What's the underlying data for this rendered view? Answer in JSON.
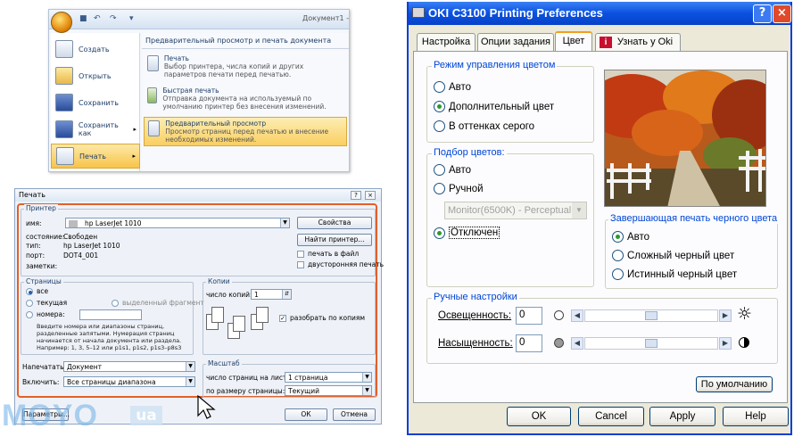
{
  "office": {
    "title": "Документ1 -",
    "left_items": [
      {
        "label": "Создать",
        "icon": "new-document-icon"
      },
      {
        "label": "Открыть",
        "icon": "open-folder-icon"
      },
      {
        "label": "Сохранить",
        "icon": "save-icon"
      },
      {
        "label": "Сохранить как",
        "icon": "save-as-icon"
      },
      {
        "label": "Печать",
        "icon": "printer-icon"
      }
    ],
    "right_header": "Предварительный просмотр и печать документа",
    "right_items": [
      {
        "title": "Печать",
        "desc": "Выбор принтера, числа копий и других параметров печати перед печатью."
      },
      {
        "title": "Быстрая печать",
        "desc": "Отправка документа на используемый по умолчанию принтер без внесения изменений."
      },
      {
        "title": "Предварительный просмотр",
        "desc": "Просмотр страниц перед печатью и внесение необходимых изменений."
      }
    ]
  },
  "print": {
    "title": "Печать",
    "printer_group": "Принтер",
    "name_label": "имя:",
    "name_value": "hp LaserJet 1010",
    "properties_btn": "Свойства",
    "state_label": "состояние:",
    "state_value": "Свободен",
    "type_label": "тип:",
    "type_value": "hp LaserJet 1010",
    "port_label": "порт:",
    "port_value": "DOT4_001",
    "notes_label": "заметки:",
    "find_btn": "Найти принтер...",
    "to_file": "печать в файл",
    "duplex": "двусторонняя печать",
    "pages_group": "Страницы",
    "all": "все",
    "current": "текущая",
    "selection": "выделенный фрагмент",
    "numbers": "номера:",
    "hint": "Введите номера или диапазоны страниц, разделенные запятыми. Нумерация страниц начинается от начала документа или раздела. Например: 1, 3, 5–12 или p1s1, p1s2, p1s3–p8s3",
    "copies_group": "Копии",
    "copies_label": "число копий:",
    "copies_value": "1",
    "collate": "разобрать по копиям",
    "print_what_label": "Напечатать:",
    "print_what_value": "Документ",
    "include_label": "Включить:",
    "include_value": "Все страницы диапазона",
    "scale_group": "Масштаб",
    "pps_label": "число страниц на листе:",
    "pps_value": "1 страница",
    "fit_label": "по размеру страницы:",
    "fit_value": "Текущий",
    "params_btn": "Параметры...",
    "ok_btn": "ОК",
    "cancel_btn": "Отмена"
  },
  "watermark": {
    "brand": "MOYO",
    "tld": "ua"
  },
  "oki": {
    "title": "OKI C3100 Printing Preferences",
    "tabs": [
      "Настройка",
      "Опции задания",
      "Цвет",
      "Узнать у Oki"
    ],
    "active_tab": "Цвет",
    "color_mode_group": "Режим управления цветом",
    "color_modes": [
      "Авто",
      "Дополнительный цвет",
      "В оттенках серого"
    ],
    "color_mode_selected": "Дополнительный цвет",
    "match_group": "Подбор цветов:",
    "match_options": [
      "Авто",
      "Ручной"
    ],
    "monitor_value": "Monitor(6500K) - Perceptual",
    "match_off": "Отключен",
    "match_selected": "Отключен",
    "black_group": "Завершающая печать черного цвета",
    "black_options": [
      "Авто",
      "Сложный черный цвет",
      "Истинный черный цвет"
    ],
    "black_selected": "Авто",
    "manual_group": "Ручные настройки",
    "brightness_label": "Освещенность:",
    "brightness_value": "0",
    "saturation_label": "Насыщенность:",
    "saturation_value": "0",
    "default_btn": "По умолчанию",
    "buttons": [
      "OK",
      "Cancel",
      "Apply",
      "Help"
    ]
  }
}
